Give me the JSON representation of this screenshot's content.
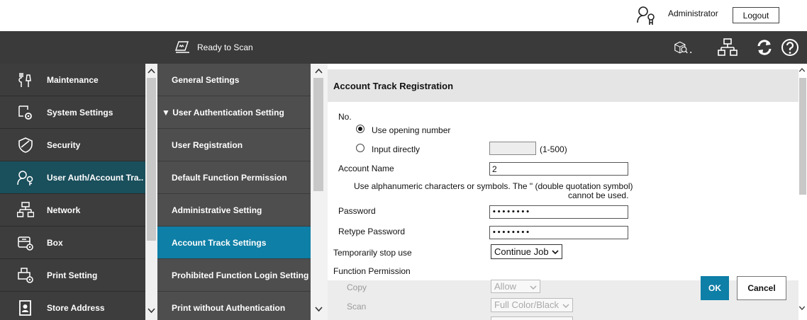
{
  "header": {
    "user_name": "Administrator",
    "logout_label": "Logout",
    "user_icon": "user-key-icon"
  },
  "toolbar": {
    "status_text": "Ready to Scan",
    "status_icon": "scanner-icon",
    "icons": [
      "box-check-icon",
      "network-icon",
      "refresh-icon",
      "help-icon"
    ]
  },
  "left_menu": {
    "items": [
      {
        "label": "Maintenance",
        "icon": "tools-icon"
      },
      {
        "label": "System Settings",
        "icon": "system-gear-icon"
      },
      {
        "label": "Security",
        "icon": "shield-icon"
      },
      {
        "label": "User Auth/Account Tra..",
        "icon": "user-key-icon",
        "active": true
      },
      {
        "label": "Network",
        "icon": "network-icon"
      },
      {
        "label": "Box",
        "icon": "box-icon"
      },
      {
        "label": "Print Setting",
        "icon": "printer-gear-icon"
      },
      {
        "label": "Store Address",
        "icon": "address-book-icon"
      }
    ]
  },
  "sub_menu": {
    "items": [
      {
        "label": "General Settings"
      },
      {
        "label": "▼ User Authentication Setting"
      },
      {
        "label": "User Registration"
      },
      {
        "label": "Default Function Permission"
      },
      {
        "label": "Administrative Setting"
      },
      {
        "label": "Account Track Settings",
        "active": true
      },
      {
        "label": "Prohibited Function Login Setting"
      },
      {
        "label": "Print without Authentication"
      }
    ]
  },
  "form": {
    "title": "Account Track Registration",
    "no_label": "No.",
    "opening_number_label": "Use opening number",
    "input_directly_label": "Input directly",
    "number_range": "(1-500)",
    "number_value": "",
    "account_name_label": "Account Name",
    "account_name_value": "2",
    "hint_line1": "Use alphanumeric characters or symbols. The \" (double quotation symbol)",
    "hint_line2": "cannot be used.",
    "password_label": "Password",
    "password_value": "••••••••",
    "retype_password_label": "Retype Password",
    "retype_password_value": "••••••••",
    "stop_use_label": "Temporarily stop use",
    "stop_use_value": "Continue Job",
    "function_permission_label": "Function Permission",
    "permissions": [
      {
        "label": "Copy",
        "value": "Allow"
      },
      {
        "label": "Scan",
        "value": "Full Color/Black"
      }
    ],
    "ok_label": "OK",
    "cancel_label": "Cancel"
  }
}
